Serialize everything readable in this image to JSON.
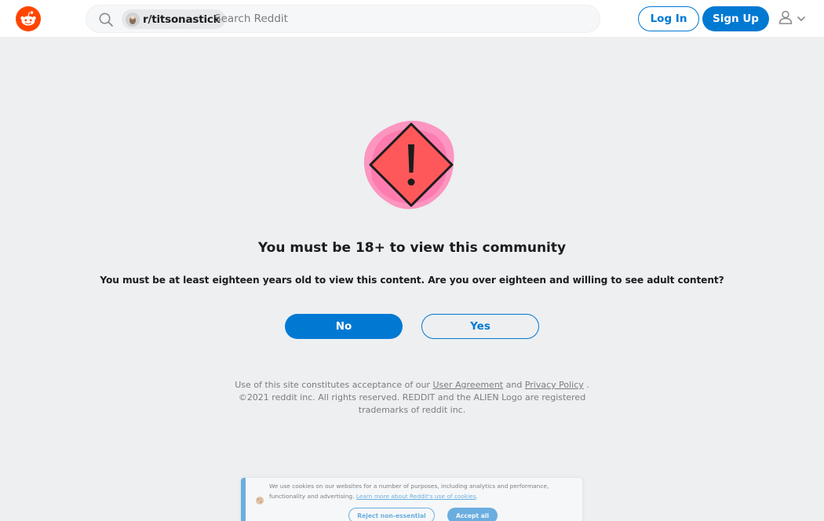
{
  "header": {
    "logo_icon": "reddit-logo-icon",
    "search": {
      "icon": "search-icon",
      "community_chip": "r/titsonastick",
      "placeholder": "Search Reddit",
      "value": ""
    },
    "login_label": "Log In",
    "signup_label": "Sign Up",
    "user_menu_icon": "user-icon",
    "chevron_icon": "chevron-down-icon"
  },
  "gate": {
    "icon": "warning-icon",
    "title": "You must be 18+ to view this community",
    "message": "You must be at least eighteen years old to view this content. Are you over eighteen and willing to see adult content?",
    "no_label": "No",
    "yes_label": "Yes"
  },
  "legal": {
    "prefix": "Use of this site constitutes acceptance of our ",
    "user_agreement": "User Agreement",
    "and": " and ",
    "privacy_policy": "Privacy Policy",
    "suffix": " .",
    "copyright": "©2021 reddit inc. All rights reserved. REDDIT and the ALIEN Logo are registered trademarks of reddit inc."
  },
  "cookie_banner": {
    "icon": "cookie-icon",
    "text": "We use cookies on our websites for a number of purposes, including analytics and performance, functionality and advertising.",
    "link": "Learn more about Reddit's use of cookies",
    "link_suffix": ".",
    "reject_label": "Reject non-essential",
    "accept_label": "Accept all"
  },
  "colors": {
    "brand": "#ff4500",
    "accent": "#0079d3",
    "background": "#edeff1",
    "warning_red": "#ff585b",
    "warning_pink": "#ff7eb3"
  }
}
